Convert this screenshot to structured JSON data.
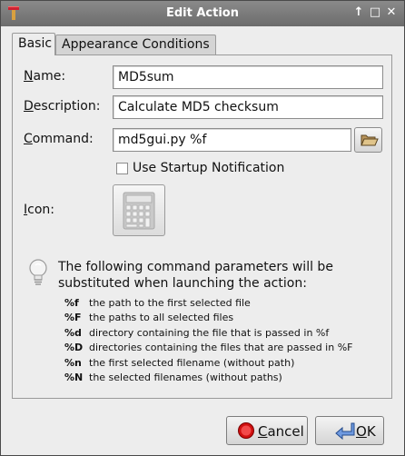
{
  "window": {
    "title": "Edit Action",
    "controls": [
      "↑",
      "□",
      "✕"
    ]
  },
  "tabs": [
    {
      "label": "Basic",
      "active": true
    },
    {
      "label": "Appearance Conditions",
      "active": false
    }
  ],
  "form": {
    "name_label_ul": "N",
    "name_label_rest": "ame:",
    "name_value": "MD5sum",
    "desc_label_ul": "D",
    "desc_label_rest": "escription:",
    "desc_value": "Calculate MD5 checksum",
    "cmd_label_ul": "C",
    "cmd_label_rest": "ommand:",
    "cmd_value": "md5gui.py %f",
    "startup_label": "Use Startup Notification",
    "startup_checked": false,
    "icon_label_ul": "I",
    "icon_label_rest": "con:"
  },
  "info": {
    "text": "The following command parameters will be substituted when launching the action:",
    "params": [
      {
        "key": "%f",
        "desc": "the path to the first selected file"
      },
      {
        "key": "%F",
        "desc": "the paths to all selected files"
      },
      {
        "key": "%d",
        "desc": "directory containing the file that is passed in %f"
      },
      {
        "key": "%D",
        "desc": "directories containing the files that are passed in %F"
      },
      {
        "key": "%n",
        "desc": "the first selected filename (without path)"
      },
      {
        "key": "%N",
        "desc": "the selected filenames (without paths)"
      }
    ]
  },
  "buttons": {
    "cancel_ul": "C",
    "cancel_rest": "ancel",
    "ok_ul": "O",
    "ok_rest": "K"
  },
  "colors": {
    "cancel_icon": "#d01010",
    "ok_icon": "#3a6fc8",
    "titlebar": "#7a7a7a"
  }
}
